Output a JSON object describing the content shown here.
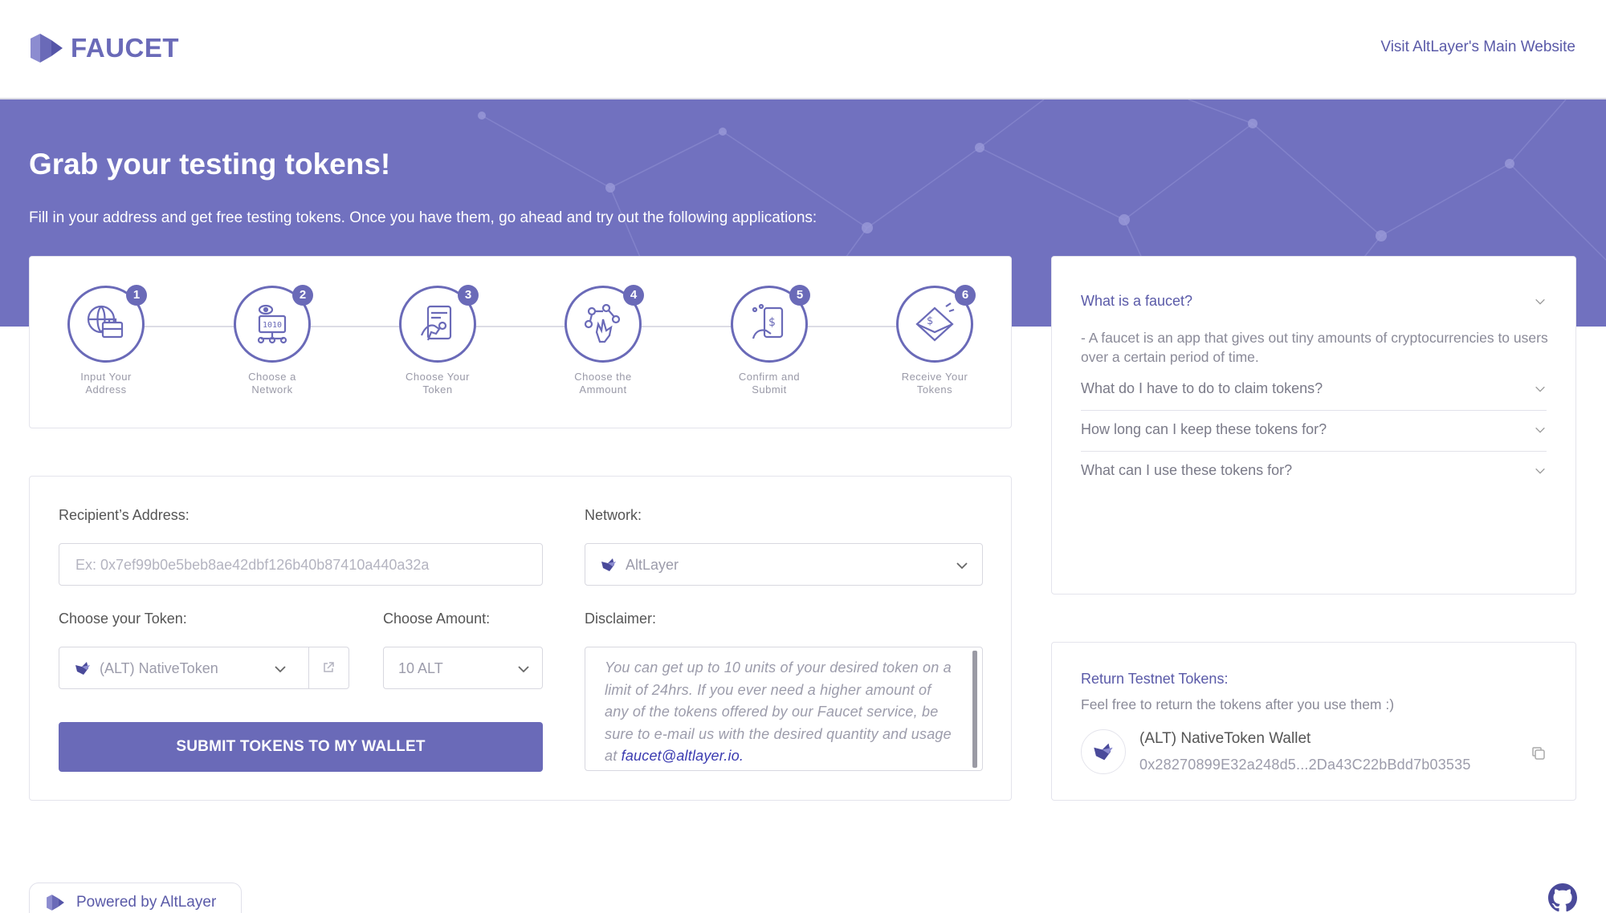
{
  "header": {
    "logo_text": "FAUCET",
    "main_site_link": "Visit AltLayer's Main Website"
  },
  "hero": {
    "title": "Grab your testing tokens!",
    "subtitle": "Fill in your address and get free testing tokens. Once you have them, go ahead and try out the following applications:"
  },
  "steps": [
    {
      "num": "1",
      "label": "Input Your Address",
      "icon": "wallet-globe-icon"
    },
    {
      "num": "2",
      "label": "Choose a Network",
      "icon": "network-chip-icon"
    },
    {
      "num": "3",
      "label": "Choose Your Token",
      "icon": "token-tablet-icon"
    },
    {
      "num": "4",
      "label": "Choose the Ammount",
      "icon": "amount-hand-icon"
    },
    {
      "num": "5",
      "label": "Confirm and Submit",
      "icon": "confirm-phone-icon"
    },
    {
      "num": "6",
      "label": "Receive Your Tokens",
      "icon": "receive-envelope-icon"
    }
  ],
  "form": {
    "recipient_label": "Recipient’s Address:",
    "recipient_placeholder": "Ex: 0x7ef99b0e5beb8ae42dbf126b40b87410a440a32a",
    "network_label": "Network:",
    "network_value": "AltLayer",
    "token_label": "Choose your Token:",
    "token_value": "(ALT) NativeToken",
    "amount_label": "Choose Amount:",
    "amount_value": "10 ALT",
    "disclaimer_label": "Disclaimer:",
    "disclaimer_text": "You can get up to 10 units of your desired token on a limit of 24hrs. If you ever need a higher amount of any of the tokens offered by our Faucet service, be sure to e-mail us with the desired quantity and usage at ",
    "disclaimer_email": "faucet@altlayer.io.",
    "submit_label": "SUBMIT TOKENS TO MY WALLET"
  },
  "faq": {
    "items": [
      {
        "question": "What is a faucet?",
        "answer": "- A faucet is an app that gives out tiny amounts of cryptocurrencies to users over a certain period of time.",
        "expanded": true
      },
      {
        "question": "What do I have to do to claim tokens?",
        "expanded": false
      },
      {
        "question": "How long can I keep these tokens for?",
        "expanded": false
      },
      {
        "question": "What can I use these tokens for?",
        "expanded": false
      }
    ]
  },
  "return_tokens": {
    "title": "Return Testnet Tokens:",
    "subtitle": "Feel free to return the tokens after you use them :)",
    "wallet_name": "(ALT) NativeToken Wallet",
    "wallet_address": "0x28270899E32a248d5...2Da43C22bBdd7b03535"
  },
  "footer": {
    "powered_by": "Powered by AltLayer"
  },
  "colors": {
    "brand": "#6a6ab8",
    "hero_bg": "#7171bf",
    "link": "#5a5aa8"
  }
}
